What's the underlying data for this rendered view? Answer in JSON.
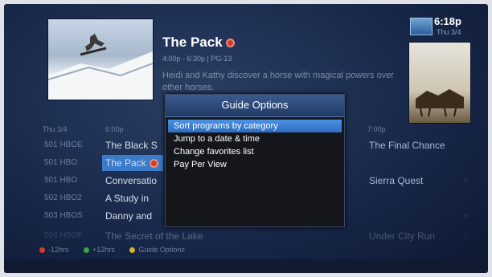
{
  "now_playing": {
    "title": "The Pack",
    "meta": "4:00p - 6:30p | PG-13",
    "description": "Heidi and Kathy discover a horse with magical powers over other horses."
  },
  "clock": {
    "time": "6:18p",
    "date": "Thu 3/4"
  },
  "grid": {
    "date": "Thu 3/4",
    "times": [
      "6:00p",
      "7:00p"
    ],
    "rows": [
      {
        "channel": "501 HBOE",
        "program": "The Black S",
        "next": "The Final Chance",
        "dim": false
      },
      {
        "channel": "501 HBO",
        "program": "The Pack",
        "next": "",
        "dim": false,
        "selected": true
      },
      {
        "channel": "501 HBO",
        "program": "Conversatio",
        "next": "Sierra Quest",
        "dim": false
      },
      {
        "channel": "502 HBO2",
        "program": "A Study in",
        "next": "",
        "dim": false
      },
      {
        "channel": "503 HBOS",
        "program": "Danny and",
        "next": "",
        "dim": false
      },
      {
        "channel": "504 HBOF",
        "program": "The Secret of the Lake",
        "next": "Under City Run",
        "dim": true
      }
    ]
  },
  "legend": [
    {
      "label": "-12hrs",
      "color": "#d23c2a"
    },
    {
      "label": "+12hrs",
      "color": "#3fa34a"
    },
    {
      "label": "Guide Options",
      "color": "#d6b52b"
    }
  ],
  "dialog": {
    "title": "Guide Options",
    "items": [
      "Sort programs by category",
      "Jump to a date & time",
      "Change favorites list",
      "Pay Per View"
    ],
    "selected_index": 0
  }
}
